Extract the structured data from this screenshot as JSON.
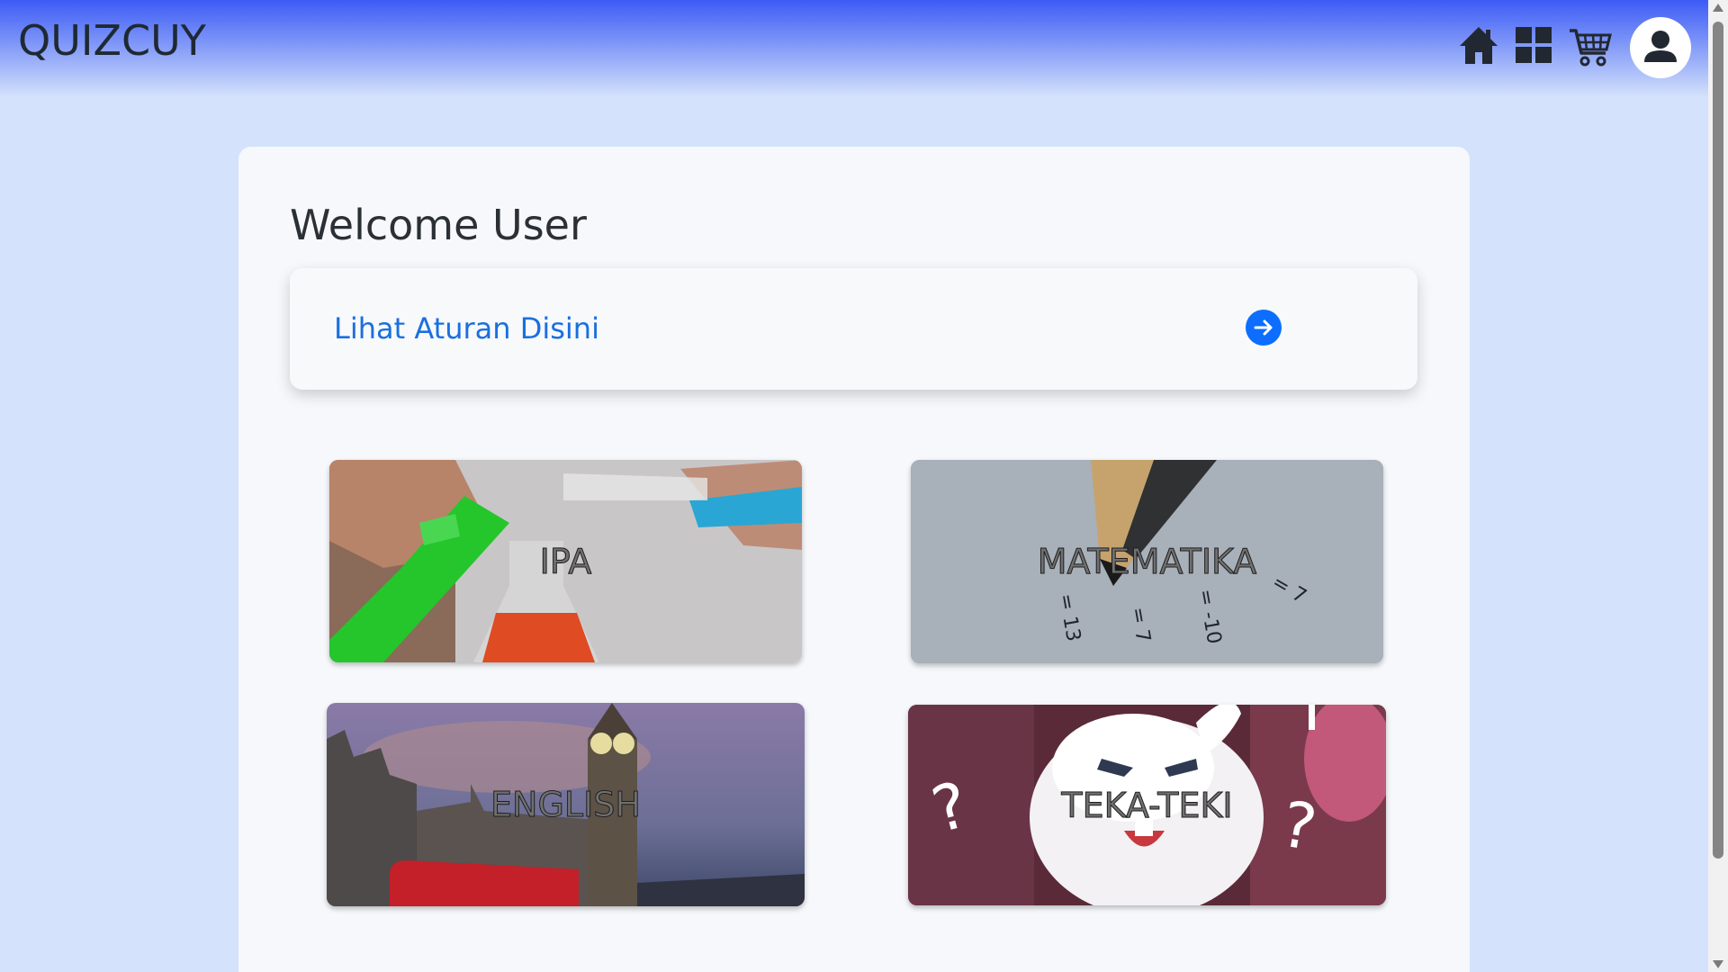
{
  "header": {
    "brand": "QUIZCUY",
    "icons": [
      "home-icon",
      "dashboard-grid-icon",
      "shopping-cart-icon",
      "user-avatar-icon"
    ],
    "gradient_top": "#3d5bf5",
    "background": "#d4e2fb"
  },
  "main": {
    "welcome": "Welcome User",
    "rules_link": "Lihat Aturan Disini",
    "accent": "#0d6efd",
    "subjects": [
      {
        "label": "IPA"
      },
      {
        "label": "MATEMATIKA"
      },
      {
        "label": "ENGLISH"
      },
      {
        "label": "TEKA-TEKI"
      }
    ]
  }
}
